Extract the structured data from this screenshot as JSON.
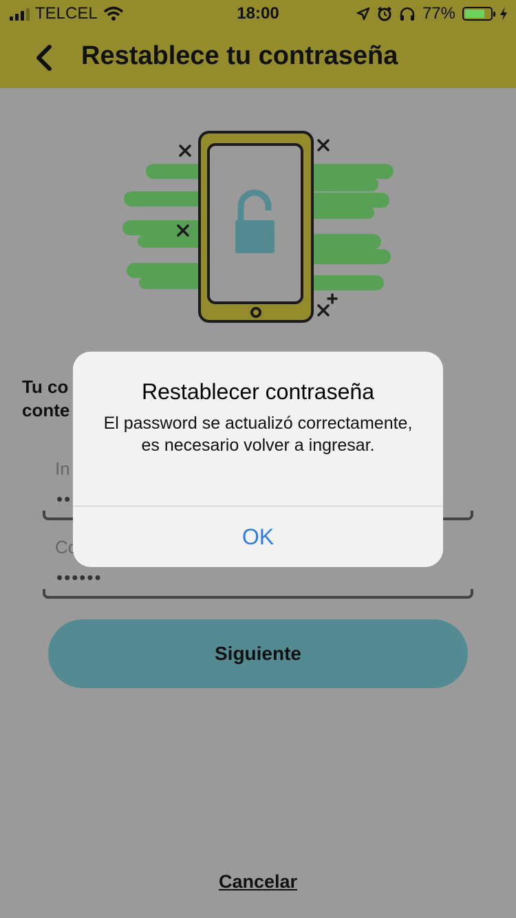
{
  "status_bar": {
    "carrier": "TELCEL",
    "time": "18:00",
    "battery_percent": "77%",
    "battery_level": 0.77,
    "signal_bars": 3,
    "icons": [
      "signal-icon",
      "wifi-icon",
      "location-icon",
      "alarm-icon",
      "headphones-icon",
      "battery-icon",
      "charging-icon"
    ]
  },
  "header": {
    "title": "Restablece tu contraseña",
    "back_icon": "chevron-left-icon"
  },
  "content": {
    "subtitle_line1": "Tu co",
    "subtitle_line2": "conte",
    "fields": [
      {
        "label": "In",
        "value": "••"
      },
      {
        "label": "Co",
        "value": "••••••"
      }
    ],
    "primary_button": "Siguiente",
    "cancel_link": "Cancelar"
  },
  "alert": {
    "title": "Restablecer contraseña",
    "message": "El password se actualizó correctamente, es necesario volver a ingresar.",
    "ok_button": "OK"
  },
  "colors": {
    "header": "#948b2c",
    "button": "#548b93",
    "alert_link": "#2f7be7",
    "illustration_green": "#58a055"
  }
}
